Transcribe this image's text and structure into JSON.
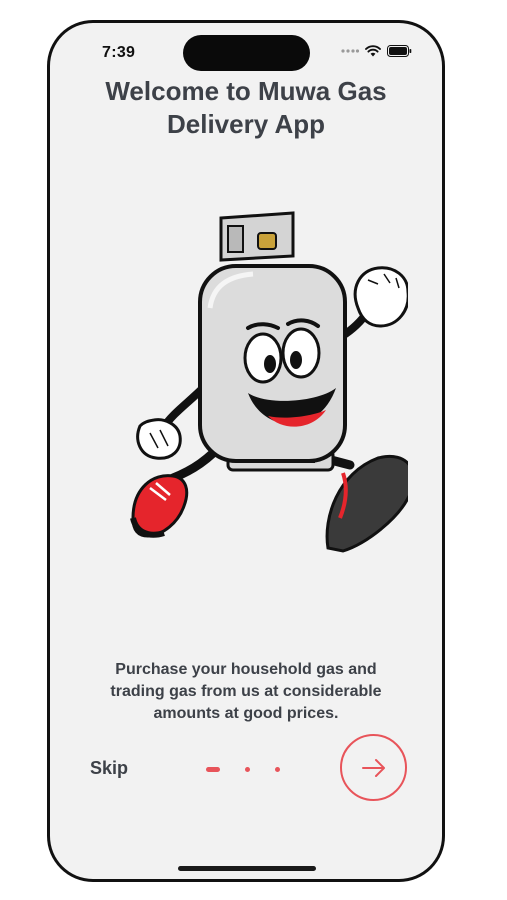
{
  "status_bar": {
    "time": "7:39",
    "icons": [
      "cellular-dots-icon",
      "wifi-icon",
      "battery-icon"
    ]
  },
  "onboarding": {
    "title_line1": "Welcome to Muwa Gas",
    "title_line2": "Delivery App",
    "description_line1": "Purchase your household gas and",
    "description_line2": "trading gas from us at considerable",
    "description_line3": "amounts at good prices.",
    "skip_label": "Skip",
    "page_count": 3,
    "current_page": 1,
    "next_icon": "arrow-right-icon"
  },
  "colors": {
    "accent": "#e8545a",
    "text": "#3d4148",
    "background": "#f2f2f2"
  }
}
